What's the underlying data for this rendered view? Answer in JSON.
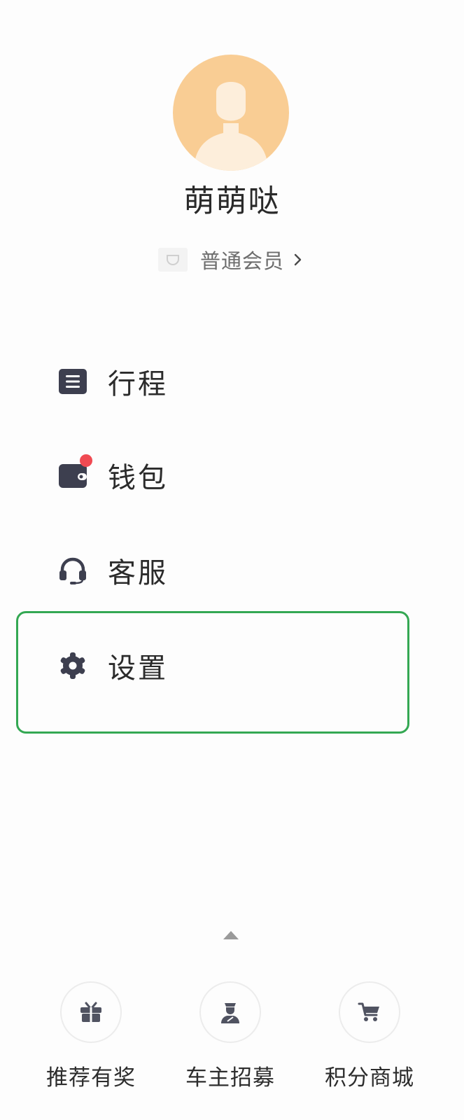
{
  "profile": {
    "username": "萌萌哒",
    "membership_label": "普通会员"
  },
  "menu": {
    "items": [
      {
        "label": "行程",
        "icon": "trip-list-icon"
      },
      {
        "label": "钱包",
        "icon": "wallet-icon",
        "has_notification_dot": true
      },
      {
        "label": "客服",
        "icon": "headset-icon"
      },
      {
        "label": "设置",
        "icon": "gear-icon",
        "highlighted": true
      }
    ]
  },
  "shortcuts": {
    "items": [
      {
        "label": "推荐有奖",
        "icon": "gift-icon"
      },
      {
        "label": "车主招募",
        "icon": "driver-icon"
      },
      {
        "label": "积分商城",
        "icon": "cart-icon"
      }
    ]
  },
  "colors": {
    "avatar_bg": "#f9cd94",
    "icon_dark": "#3d3f4f",
    "notification_dot": "#f04a52",
    "highlight_border": "#34a853",
    "shortcut_icon": "#505361"
  }
}
